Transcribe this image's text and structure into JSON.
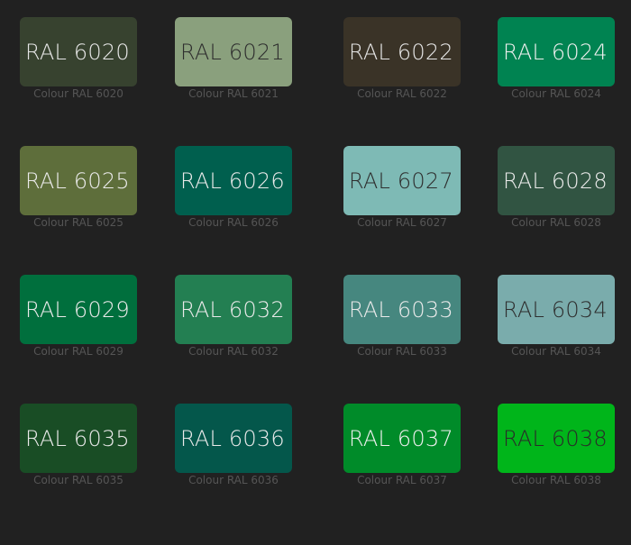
{
  "swatches": [
    {
      "code": "RAL 6020",
      "caption": "Colour RAL 6020",
      "color": "#37422F",
      "text_color": "#E6E6E6"
    },
    {
      "code": "RAL 6021",
      "caption": "Colour RAL 6021",
      "color": "#8AA07D",
      "text_color": "#2E2E2E"
    },
    {
      "code": "RAL 6022",
      "caption": "Colour RAL 6022",
      "color": "#3A3327",
      "text_color": "#E6E6E6"
    },
    {
      "code": "RAL 6024",
      "caption": "Colour RAL 6024",
      "color": "#008351",
      "text_color": "#F0F0F0"
    },
    {
      "code": "RAL 6025",
      "caption": "Colour RAL 6025",
      "color": "#5E6E3B",
      "text_color": "#EAEAEA"
    },
    {
      "code": "RAL 6026",
      "caption": "Colour RAL 6026",
      "color": "#005F4E",
      "text_color": "#EAEAEA"
    },
    {
      "code": "RAL 6027",
      "caption": "Colour RAL 6027",
      "color": "#7EBAB5",
      "text_color": "#2E2E2E"
    },
    {
      "code": "RAL 6028",
      "caption": "Colour RAL 6028",
      "color": "#315442",
      "text_color": "#EAEAEA"
    },
    {
      "code": "RAL 6029",
      "caption": "Colour RAL 6029",
      "color": "#006F3D",
      "text_color": "#EAEAEA"
    },
    {
      "code": "RAL 6032",
      "caption": "Colour RAL 6032",
      "color": "#237F52",
      "text_color": "#EAEAEA"
    },
    {
      "code": "RAL 6033",
      "caption": "Colour RAL 6033",
      "color": "#46877F",
      "text_color": "#EAEAEA"
    },
    {
      "code": "RAL 6034",
      "caption": "Colour RAL 6034",
      "color": "#7AACAC",
      "text_color": "#2E2E2E"
    },
    {
      "code": "RAL 6035",
      "caption": "Colour RAL 6035",
      "color": "#194D25",
      "text_color": "#EAEAEA"
    },
    {
      "code": "RAL 6036",
      "caption": "Colour RAL 6036",
      "color": "#04574B",
      "text_color": "#EAEAEA"
    },
    {
      "code": "RAL 6037",
      "caption": "Colour RAL 6037",
      "color": "#008B29",
      "text_color": "#F0F0F0"
    },
    {
      "code": "RAL 6038",
      "caption": "Colour RAL 6038",
      "color": "#00B51A",
      "text_color": "#2A2A2A"
    }
  ]
}
